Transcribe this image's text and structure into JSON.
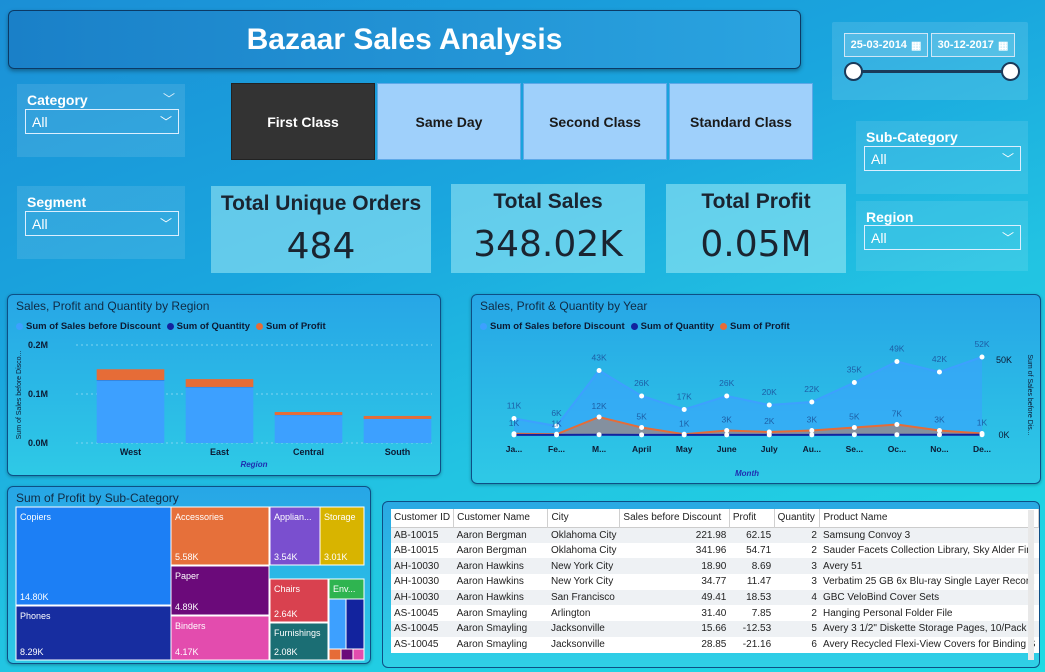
{
  "header": {
    "title": "Bazaar Sales Analysis"
  },
  "date_range": {
    "start": "25-03-2014",
    "end": "30-12-2017"
  },
  "slicers": {
    "category": {
      "label": "Category",
      "value": "All"
    },
    "segment": {
      "label": "Segment",
      "value": "All"
    },
    "sub_category": {
      "label": "Sub-Category",
      "value": "All"
    },
    "region": {
      "label": "Region",
      "value": "All"
    }
  },
  "ship_modes": [
    {
      "label": "First Class",
      "active": true
    },
    {
      "label": "Same Day",
      "active": false
    },
    {
      "label": "Second Class",
      "active": false
    },
    {
      "label": "Standard Class",
      "active": false
    }
  ],
  "kpis": {
    "orders": {
      "title": "Total Unique Orders",
      "value": "484"
    },
    "sales": {
      "title": "Total Sales",
      "value": "348.02K"
    },
    "profit": {
      "title": "Total Profit",
      "value": "0.05M"
    }
  },
  "colors": {
    "sales": "#3da0ff",
    "quantity": "#12239e",
    "profit": "#e66c37"
  },
  "chart_data": [
    {
      "type": "bar",
      "title": "Sales, Profit and Quantity by Region",
      "xlabel": "Region",
      "ylabel": "Sum of Sales before Disco...",
      "legend": [
        "Sum of Sales before Discount",
        "Sum of Quantity",
        "Sum of Profit"
      ],
      "y_ticks": [
        "0.0M",
        "0.1M",
        "0.2M"
      ],
      "ylim": [
        0,
        0.2
      ],
      "categories": [
        "West",
        "East",
        "Central",
        "South"
      ],
      "series": [
        {
          "name": "Sum of Sales before Discount",
          "values": [
            0.128,
            0.114,
            0.057,
            0.049
          ]
        },
        {
          "name": "Sum of Quantity",
          "values": [
            0.0005,
            0.0004,
            0.0002,
            0.0002
          ]
        },
        {
          "name": "Sum of Profit",
          "values": [
            0.022,
            0.016,
            0.006,
            0.006
          ]
        }
      ]
    },
    {
      "type": "area",
      "title": "Sales, Profit & Quantity by Year",
      "xlabel": "Month",
      "ylabel": "Sum of Sales before Dis...",
      "legend": [
        "Sum of Sales before Discount",
        "Sum of Quantity",
        "Sum of Profit"
      ],
      "y_ticks": [
        "0K",
        "50K"
      ],
      "ylim": [
        0,
        60
      ],
      "categories": [
        "Ja...",
        "Fe...",
        "M...",
        "April",
        "May",
        "June",
        "July",
        "Au...",
        "Se...",
        "Oc...",
        "No...",
        "De..."
      ],
      "series": [
        {
          "name": "Sum of Sales before Discount",
          "values": [
            11,
            6,
            43,
            26,
            17,
            26,
            20,
            22,
            35,
            49,
            42,
            52
          ],
          "labels": [
            "11K",
            "6K",
            "43K",
            "26K",
            "17K",
            "26K",
            "20K",
            "22K",
            "35K",
            "49K",
            "42K",
            "52K"
          ]
        },
        {
          "name": "Sum of Quantity",
          "values": [
            0.1,
            0.1,
            0.2,
            0.1,
            0.1,
            0.1,
            0.1,
            0.1,
            0.2,
            0.2,
            0.2,
            0.2
          ],
          "labels": [
            "0K",
            "0K",
            "0K",
            "0K",
            "0K",
            "0K",
            "0K",
            "0K",
            "0K",
            "0K",
            "0K",
            "0K"
          ]
        },
        {
          "name": "Sum of Profit",
          "values": [
            0.8,
            0.5,
            12,
            5,
            0.5,
            3,
            2,
            3,
            5,
            7,
            3,
            1
          ],
          "labels": [
            "1K",
            "1K",
            "12K",
            "5K",
            "1K",
            "3K",
            "2K",
            "3K",
            "5K",
            "7K",
            "3K",
            "1K"
          ]
        }
      ]
    },
    {
      "type": "heatmap",
      "title": "Sum of Profit by Sub-Category",
      "cells": [
        {
          "name": "Copiers",
          "label": "14.80K",
          "value": 14.8,
          "color": "#1c7ff5"
        },
        {
          "name": "Phones",
          "label": "8.29K",
          "value": 8.29,
          "color": "#172da0"
        },
        {
          "name": "Accessories",
          "label": "5.58K",
          "value": 5.58,
          "color": "#e6703a"
        },
        {
          "name": "Paper",
          "label": "4.89K",
          "value": 4.89,
          "color": "#6b0a7a"
        },
        {
          "name": "Binders",
          "label": "4.17K",
          "value": 4.17,
          "color": "#e34cae"
        },
        {
          "name": "Applian...",
          "label": "3.54K",
          "value": 3.54,
          "color": "#7a4fcf"
        },
        {
          "name": "Storage",
          "label": "3.01K",
          "value": 3.01,
          "color": "#d8b400"
        },
        {
          "name": "Chairs",
          "label": "2.64K",
          "value": 2.64,
          "color": "#d9414f"
        },
        {
          "name": "Furnishings",
          "label": "2.08K",
          "value": 2.08,
          "color": "#1b6e74"
        },
        {
          "name": "Env...",
          "label": "",
          "value": 1.2,
          "color": "#2fb450"
        }
      ]
    }
  ],
  "table": {
    "columns": [
      "Customer ID",
      "Customer Name",
      "City",
      "Sales before Discount",
      "Profit",
      "Quantity",
      "Product Name"
    ],
    "rows": [
      [
        "AB-10015",
        "Aaron Bergman",
        "Oklahoma City",
        "221.98",
        "62.15",
        "2",
        "Samsung Convoy 3"
      ],
      [
        "AB-10015",
        "Aaron Bergman",
        "Oklahoma City",
        "341.96",
        "54.71",
        "2",
        "Sauder Facets Collection Library, Sky Alder Fini"
      ],
      [
        "AH-10030",
        "Aaron Hawkins",
        "New York City",
        "18.90",
        "8.69",
        "3",
        "Avery 51"
      ],
      [
        "AH-10030",
        "Aaron Hawkins",
        "New York City",
        "34.77",
        "11.47",
        "3",
        "Verbatim 25 GB 6x Blu-ray Single Layer Record"
      ],
      [
        "AH-10030",
        "Aaron Hawkins",
        "San Francisco",
        "49.41",
        "18.53",
        "4",
        "GBC VeloBind Cover Sets"
      ],
      [
        "AS-10045",
        "Aaron Smayling",
        "Arlington",
        "31.40",
        "7.85",
        "2",
        "Hanging Personal Folder File"
      ],
      [
        "AS-10045",
        "Aaron Smayling",
        "Jacksonville",
        "15.66",
        "-12.53",
        "5",
        "Avery 3 1/2\" Diskette Storage Pages, 10/Pack"
      ],
      [
        "AS-10045",
        "Aaron Smayling",
        "Jacksonville",
        "28.85",
        "-21.16",
        "6",
        "Avery Recycled Flexi-View Covers for Binding S"
      ]
    ]
  }
}
